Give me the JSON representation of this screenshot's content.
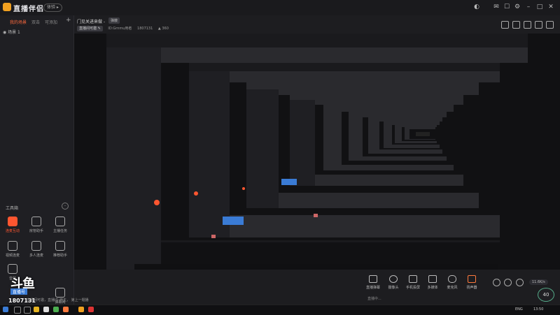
{
  "app": {
    "name": "直播伴侣",
    "version_label": "体验"
  },
  "titlebar": {
    "icons": [
      "camera-icon",
      "chat-icon",
      "settings-icon",
      "minimize-icon",
      "maximize-icon",
      "close-icon"
    ]
  },
  "left_panel": {
    "tabs": [
      {
        "label": "我的场景",
        "active": true
      },
      {
        "label": "双击",
        "active": false
      },
      {
        "label": "可添加",
        "active": false
      }
    ],
    "add_label": "+",
    "scene_item": "◉ 场景 1",
    "tools_title": "工具箱",
    "tools": [
      {
        "label": "连麦互动",
        "icon": "link-mic-icon",
        "highlight": true
      },
      {
        "label": "房管助手",
        "icon": "admin-icon",
        "highlight": false
      },
      {
        "label": "主播任务",
        "icon": "task-icon",
        "highlight": false
      },
      {
        "label": "视频连麦",
        "icon": "video-link-icon",
        "highlight": false
      },
      {
        "label": "多人连麦",
        "icon": "multi-mic-icon",
        "highlight": false
      },
      {
        "label": "推荐助手",
        "icon": "recommend-icon",
        "highlight": false
      },
      {
        "label": "音效",
        "icon": "sound-icon",
        "highlight": false
      },
      {
        "label": "",
        "icon": "blank-icon",
        "highlight": false
      },
      {
        "label": "弹幕网",
        "icon": "danmu-icon",
        "highlight": false
      }
    ]
  },
  "header": {
    "room_title": "门见关进来做 -",
    "room_tag": "弹蔽",
    "sub_items": [
      "直播间可邀 ✎",
      "ID:Grnmu用者",
      "1807131",
      "▲ 360"
    ]
  },
  "bottom_bar": {
    "buttons": [
      {
        "label": "直播弹幕",
        "icon": "danmaku-icon"
      },
      {
        "label": "摄像头",
        "icon": "camera-icon"
      },
      {
        "label": "手机投屏",
        "icon": "phone-cast-icon"
      },
      {
        "label": "多媒体",
        "icon": "media-icon"
      },
      {
        "label": "麦克风",
        "icon": "mic-icon"
      },
      {
        "label": "扬声器",
        "icon": "speaker-icon"
      }
    ],
    "status_text": "直播中...",
    "speed_label": "11.6K/s",
    "perf_value": "40"
  },
  "watermark": {
    "logo": "斗鱼",
    "tag": "直播号",
    "number": "1807131",
    "notice": "直播间可邀，直播ID:用主， 第上一题播"
  },
  "taskbar": {
    "time": "13:50",
    "lang": "ENG"
  },
  "colors": {
    "accent": "#ff5630",
    "bg": "#1d1d20",
    "preview": "#111113"
  }
}
